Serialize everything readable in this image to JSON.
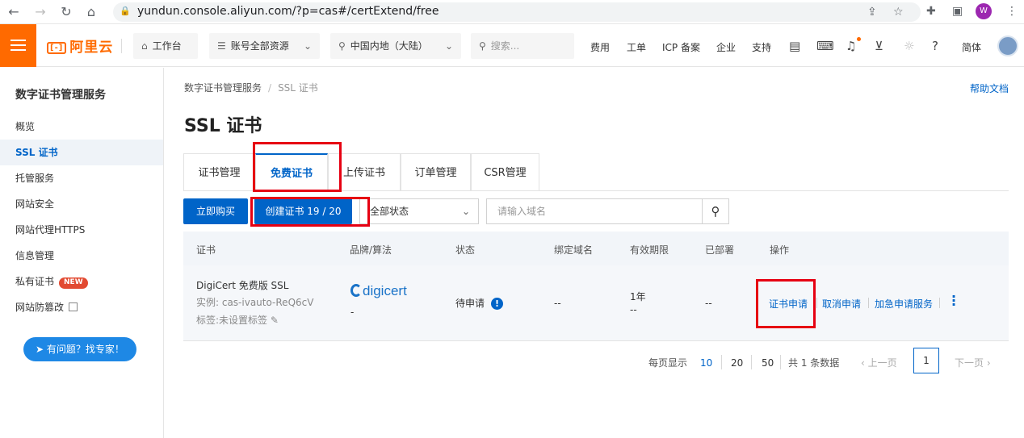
{
  "browser": {
    "url": "yundun.console.aliyun.com/?p=cas#/certExtend/free",
    "profile_initial": "W"
  },
  "topnav": {
    "logo_text": "阿里云",
    "workbench": "工作台",
    "resources": "账号全部资源",
    "region": "中国内地（大陆）",
    "search_placeholder": "搜索...",
    "links": [
      "费用",
      "工单",
      "ICP 备案",
      "企业",
      "支持"
    ],
    "language": "简体"
  },
  "sidebar": {
    "title": "数字证书管理服务",
    "items": [
      {
        "label": "概览"
      },
      {
        "label": "SSL 证书"
      },
      {
        "label": "托管服务"
      },
      {
        "label": "网站安全"
      },
      {
        "label": "网站代理HTTPS"
      },
      {
        "label": "信息管理"
      },
      {
        "label": "私有证书",
        "badge": "NEW"
      },
      {
        "label": "网站防篡改"
      }
    ],
    "expert_button": "有问题？找专家！"
  },
  "breadcrumb": {
    "root": "数字证书管理服务",
    "current": "SSL 证书"
  },
  "help_link": "帮助文档",
  "page_title": "SSL 证书",
  "tabs": [
    "证书管理",
    "免费证书",
    "上传证书",
    "订单管理",
    "CSR管理"
  ],
  "toolbar": {
    "buy_label": "立即购买",
    "create_label": "创建证书 19 / 20",
    "status_filter": "全部状态",
    "search_placeholder": "请输入域名"
  },
  "table": {
    "headers": [
      "证书",
      "品牌/算法",
      "状态",
      "绑定域名",
      "有效期限",
      "已部署",
      "操作"
    ],
    "rows": [
      {
        "cert_name": "DigiCert 免费版 SSL",
        "instance": "实例: cas-ivauto-ReQ6cV",
        "tag": "标签:未设置标签",
        "brand": "digicert",
        "algorithm": "-",
        "status": "待申请",
        "domain": "--",
        "validity": "1年",
        "validity_sub": "--",
        "deployed": "--",
        "actions": [
          "证书申请",
          "取消申请",
          "加急申请服务"
        ]
      }
    ]
  },
  "pagination": {
    "per_page_label": "每页显示",
    "sizes": [
      "10",
      "20",
      "50"
    ],
    "total": "共 1 条数据",
    "prev": "上一页",
    "current": "1",
    "next": "下一页"
  }
}
